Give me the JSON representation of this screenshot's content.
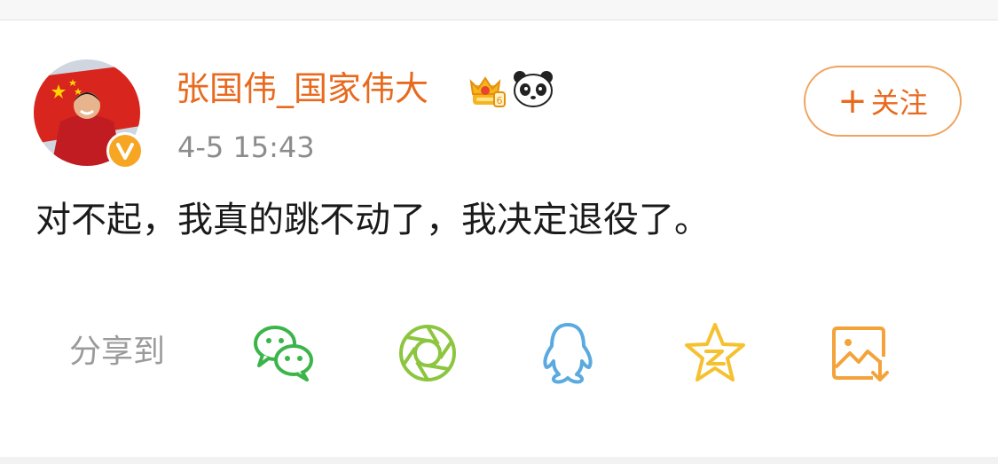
{
  "post": {
    "author": "张国伟_国家伟大",
    "timestamp": "4-5 15:43",
    "text": "对不起，我真的跳不动了，我决定退役了。",
    "follow_label": "关注",
    "follow_plus": "+"
  },
  "badges": {
    "verified": "V",
    "icons": [
      "crown-vip-icon",
      "panda-icon"
    ]
  },
  "share": {
    "label": "分享到",
    "targets": [
      {
        "name": "wechat",
        "icon": "wechat-icon",
        "color": "#3bb54a"
      },
      {
        "name": "moments",
        "icon": "moments-shutter-icon",
        "color": "#8cc63f"
      },
      {
        "name": "qq",
        "icon": "qq-penguin-icon",
        "color": "#5aaae0"
      },
      {
        "name": "qzone",
        "icon": "qzone-star-icon",
        "color": "#f6c12f"
      },
      {
        "name": "save-image",
        "icon": "save-image-icon",
        "color": "#f3a33a"
      }
    ]
  },
  "colors": {
    "accent": "#e86a1f",
    "follow_border": "#f0a35e",
    "text_primary": "#1a1a1a",
    "text_secondary": "#8c8c8c"
  }
}
